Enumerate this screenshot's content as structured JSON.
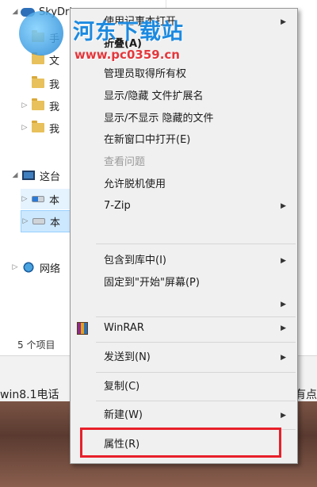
{
  "nav": {
    "items": [
      {
        "label": "SkyDrive",
        "expanded": true
      },
      {
        "label": "手"
      },
      {
        "label": "文"
      },
      {
        "label": "我"
      },
      {
        "label": "我"
      },
      {
        "label": "我"
      },
      {
        "label": "这台"
      },
      {
        "label": "本"
      },
      {
        "label": "本"
      },
      {
        "label": "网络"
      }
    ]
  },
  "status": {
    "text": "5 个项目"
  },
  "taskbar": {
    "left_text": "win8.1电话",
    "right_text": "有点"
  },
  "menu": {
    "items": [
      {
        "label": "使用记事本打开",
        "bold": false,
        "submenu": true
      },
      {
        "label": "折叠(A)",
        "bold": true
      },
      {
        "label": "管理员取得所有权"
      },
      {
        "label": "显示/隐藏 文件扩展名"
      },
      {
        "label": "显示/不显示 隐藏的文件"
      },
      {
        "label": "在新窗口中打开(E)"
      },
      {
        "label": "查看问题",
        "disabled": true
      },
      {
        "label": "允许脱机使用"
      },
      {
        "label": "7-Zip",
        "submenu": true
      },
      {
        "label": "包含到库中(I)",
        "submenu": true
      },
      {
        "label": "固定到\"开始\"屏幕(P)"
      },
      {
        "label": "WinRAR",
        "submenu": true
      },
      {
        "label": "发送到(N)",
        "submenu": true
      },
      {
        "label": "复制(C)"
      },
      {
        "label": "新建(W)",
        "submenu": true
      },
      {
        "label": "属性(R)"
      }
    ],
    "highlight_color": "#e8202a"
  },
  "watermark": {
    "title": "河东下载站",
    "url": "www.pc0359.cn"
  }
}
